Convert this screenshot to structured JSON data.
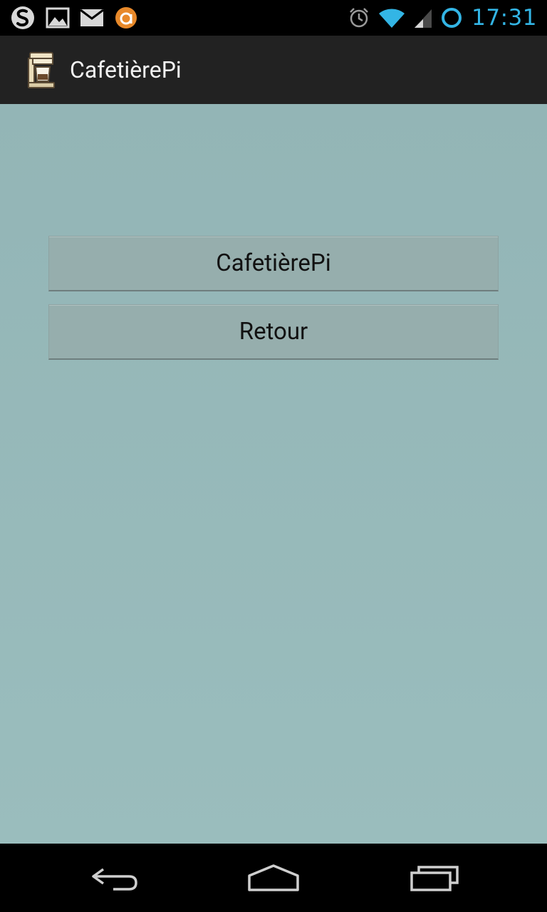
{
  "status_bar": {
    "time": "17:31",
    "left_icons": [
      "swype-icon",
      "gallery-icon",
      "mail-icon",
      "avast-icon"
    ],
    "right_icons": [
      "alarm-icon",
      "wifi-icon",
      "signal-icon",
      "sync-circle-icon"
    ],
    "accent_color": "#33b5e5"
  },
  "action_bar": {
    "title": "CafetièrePi",
    "icon": "coffee-maker-icon"
  },
  "content": {
    "buttons": [
      {
        "label": "CafetièrePi"
      },
      {
        "label": "Retour"
      }
    ],
    "background_color": "#96b9b9"
  },
  "nav_bar": {
    "buttons": [
      "back-icon",
      "home-icon",
      "recents-icon"
    ]
  }
}
